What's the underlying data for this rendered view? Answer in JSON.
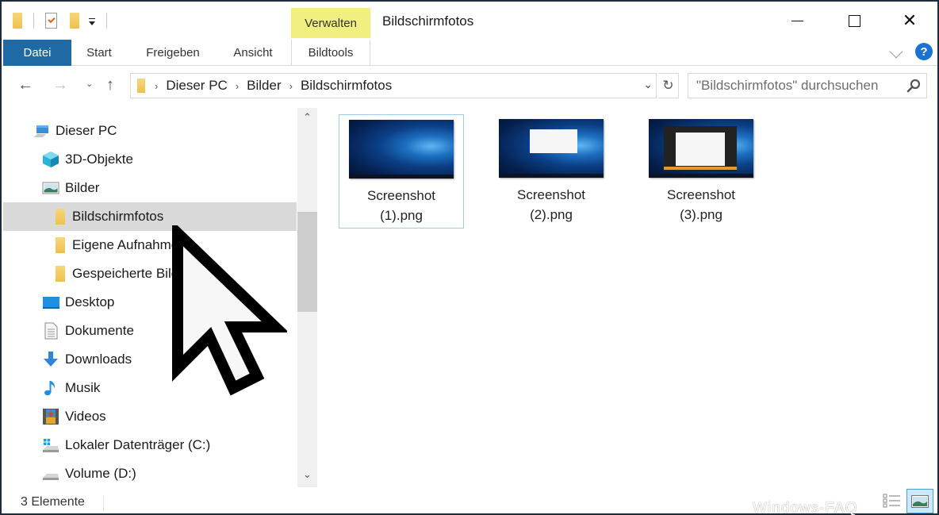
{
  "window": {
    "title": "Bildschirmfotos",
    "contextual_group": "Verwalten",
    "controls": {
      "minimize": "minimize",
      "maximize": "maximize",
      "close": "✕"
    }
  },
  "ribbon": {
    "tabs": [
      {
        "label": "Datei",
        "active": true
      },
      {
        "label": "Start"
      },
      {
        "label": "Freigeben"
      },
      {
        "label": "Ansicht"
      },
      {
        "label": "Bildtools"
      }
    ],
    "help": "?"
  },
  "navigation": {
    "back": "←",
    "forward": "→",
    "recent": "⌄",
    "up": "↑",
    "breadcrumb": [
      "Dieser PC",
      "Bilder",
      "Bildschirmfotos"
    ],
    "breadcrumb_separator": "›",
    "refresh": "↻",
    "search_placeholder": "\"Bildschirmfotos\" durchsuchen"
  },
  "sidebar": {
    "items": [
      {
        "label": "Dieser PC",
        "icon": "computer-icon",
        "level": 0
      },
      {
        "label": "3D-Objekte",
        "icon": "3d-objects-icon",
        "level": 1
      },
      {
        "label": "Bilder",
        "icon": "pictures-icon",
        "level": 1
      },
      {
        "label": "Bildschirmfotos",
        "icon": "folder-icon",
        "level": 2,
        "selected": true
      },
      {
        "label": "Eigene Aufnahmen",
        "icon": "folder-icon",
        "level": 2
      },
      {
        "label": "Gespeicherte Bilder",
        "icon": "folder-icon",
        "level": 2
      },
      {
        "label": "Desktop",
        "icon": "desktop-icon",
        "level": 1
      },
      {
        "label": "Dokumente",
        "icon": "documents-icon",
        "level": 1
      },
      {
        "label": "Downloads",
        "icon": "downloads-icon",
        "level": 1
      },
      {
        "label": "Musik",
        "icon": "music-icon",
        "level": 1
      },
      {
        "label": "Videos",
        "icon": "videos-icon",
        "level": 1
      },
      {
        "label": "Lokaler Datenträger (C:)",
        "icon": "system-drive-icon",
        "level": 1
      },
      {
        "label": "Volume (D:)",
        "icon": "drive-icon",
        "level": 1
      }
    ],
    "scroll_up": "⌃",
    "scroll_down": "⌄"
  },
  "files": [
    {
      "name_line1": "Screenshot",
      "name_line2": "(1).png",
      "focused": true
    },
    {
      "name_line1": "Screenshot",
      "name_line2": "(2).png"
    },
    {
      "name_line1": "Screenshot",
      "name_line2": "(3).png"
    }
  ],
  "status": {
    "item_count": "3 Elemente",
    "watermark": "Windows-FAQ"
  }
}
